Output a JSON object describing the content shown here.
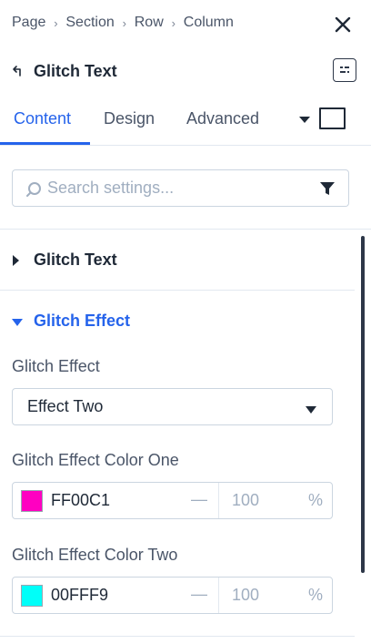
{
  "breadcrumb": {
    "items": [
      "Page",
      "Section",
      "Row",
      "Column"
    ],
    "separator": "›"
  },
  "header": {
    "back_icon": "back-arrow-icon",
    "title": "Glitch Text",
    "action_icon": "toggle-settings-icon"
  },
  "tabs": {
    "items": [
      {
        "label": "Content",
        "active": true
      },
      {
        "label": "Design",
        "active": false
      },
      {
        "label": "Advanced",
        "active": false
      }
    ],
    "accent": "#2563eb"
  },
  "search": {
    "placeholder": "Search settings...",
    "value": ""
  },
  "groups": [
    {
      "title": "Glitch Text",
      "expanded": false
    },
    {
      "title": "Glitch Effect",
      "expanded": true
    }
  ],
  "fields": {
    "effect": {
      "label": "Glitch Effect",
      "value": "Effect Two"
    },
    "color_one": {
      "label": "Glitch Effect Color One",
      "hex": "FF00C1",
      "swatch": "#FF00C1",
      "dash": "—",
      "opacity": "100",
      "unit": "%"
    },
    "color_two": {
      "label": "Glitch Effect Color Two",
      "hex": "00FFF9",
      "swatch": "#00FFF9",
      "dash": "—",
      "opacity": "100",
      "unit": "%"
    }
  }
}
